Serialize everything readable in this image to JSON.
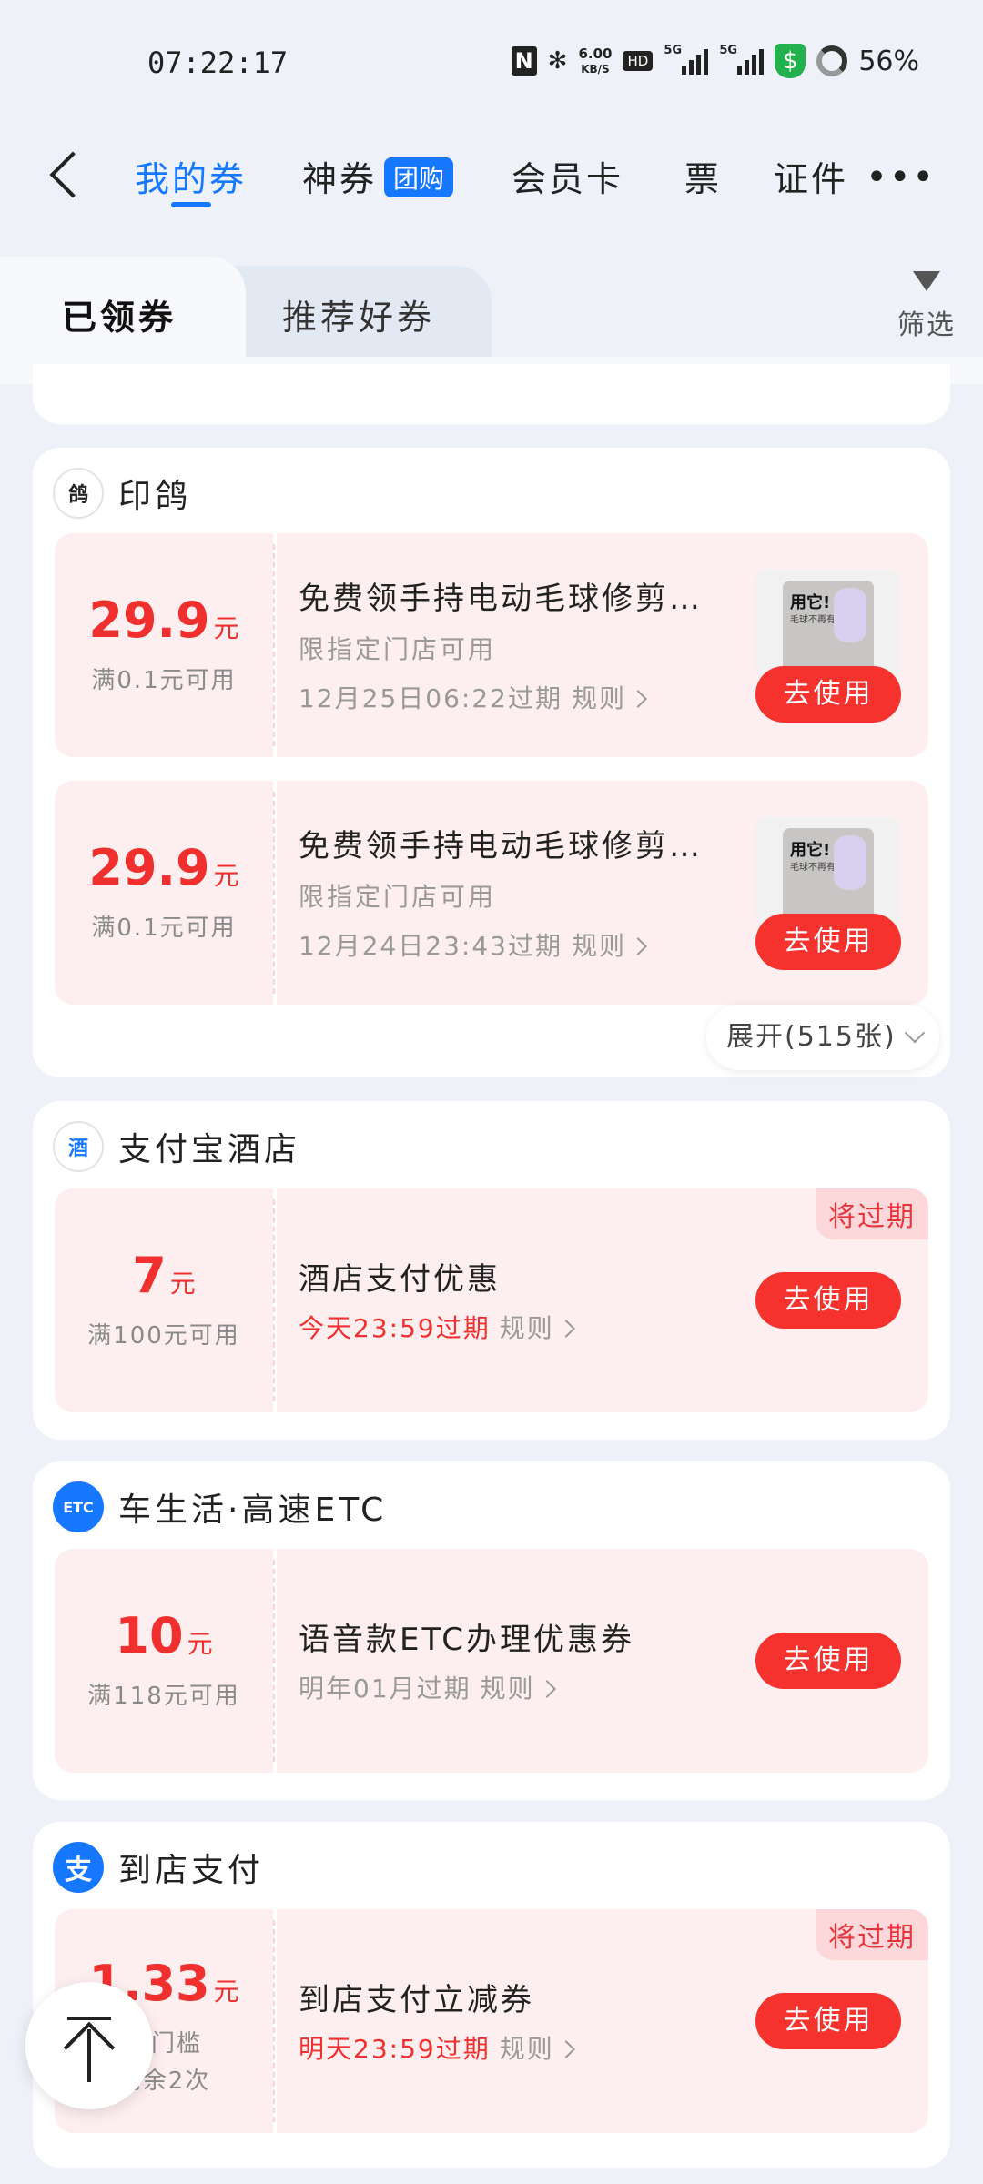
{
  "status": {
    "time": "07:22:17",
    "nfc": "N",
    "bluetooth": "✻",
    "speed_value": "6.00",
    "speed_unit": "KB/S",
    "hd": "HD",
    "sig1": "5G",
    "sig2": "5G",
    "shield": "$",
    "battery": "56%"
  },
  "nav": {
    "tabs": [
      "我的券",
      "神券",
      "会员卡",
      "票",
      "证件"
    ],
    "badge": "团购",
    "more": "•••"
  },
  "subtabs": {
    "active": "已领券",
    "inactive": "推荐好券",
    "filter": "筛选"
  },
  "cards": [
    {
      "merchant": "印鸽",
      "logo": "鸽",
      "coupons": [
        {
          "amount": "29.9",
          "unit": "元",
          "condition": "满0.1元可用",
          "title": "免费领手持电动毛球修剪…",
          "scope": "限指定门店可用",
          "expire": "12月25日06:22过期",
          "rule": "规则",
          "button": "去使用",
          "thumb_text": "用它!",
          "thumb_sub": "毛球不再有"
        },
        {
          "amount": "29.9",
          "unit": "元",
          "condition": "满0.1元可用",
          "title": "免费领手持电动毛球修剪…",
          "scope": "限指定门店可用",
          "expire": "12月24日23:43过期",
          "rule": "规则",
          "button": "去使用",
          "thumb_text": "用它!",
          "thumb_sub": "毛球不再有"
        }
      ],
      "expand": "展开(515张)"
    },
    {
      "merchant": "支付宝酒店",
      "logo": "酒",
      "coupon": {
        "amount": "7",
        "unit": "元",
        "condition": "满100元可用",
        "title": "酒店支付优惠",
        "expire": "今天23:59过期",
        "rule": "规则",
        "button": "去使用",
        "tag": "将过期"
      }
    },
    {
      "merchant": "车生活·高速ETC",
      "logo": "ETC",
      "coupon": {
        "amount": "10",
        "unit": "元",
        "condition": "满118元可用",
        "title": "语音款ETC办理优惠券",
        "expire": "明年01月过期",
        "rule": "规则",
        "button": "去使用"
      }
    },
    {
      "merchant": "到店支付",
      "logo": "支",
      "coupon": {
        "amount": "1.33",
        "unit": "元",
        "condition": "无门槛",
        "condition2": "剩余2次",
        "title": "到店支付立减券",
        "expire": "明天23:59过期",
        "rule": "规则",
        "button": "去使用",
        "tag": "将过期"
      }
    }
  ],
  "colors": {
    "accent": "#1677ff",
    "price": "#f0302e",
    "coupon_bg": "#fdeef0",
    "page_bg": "#eef2f8"
  }
}
